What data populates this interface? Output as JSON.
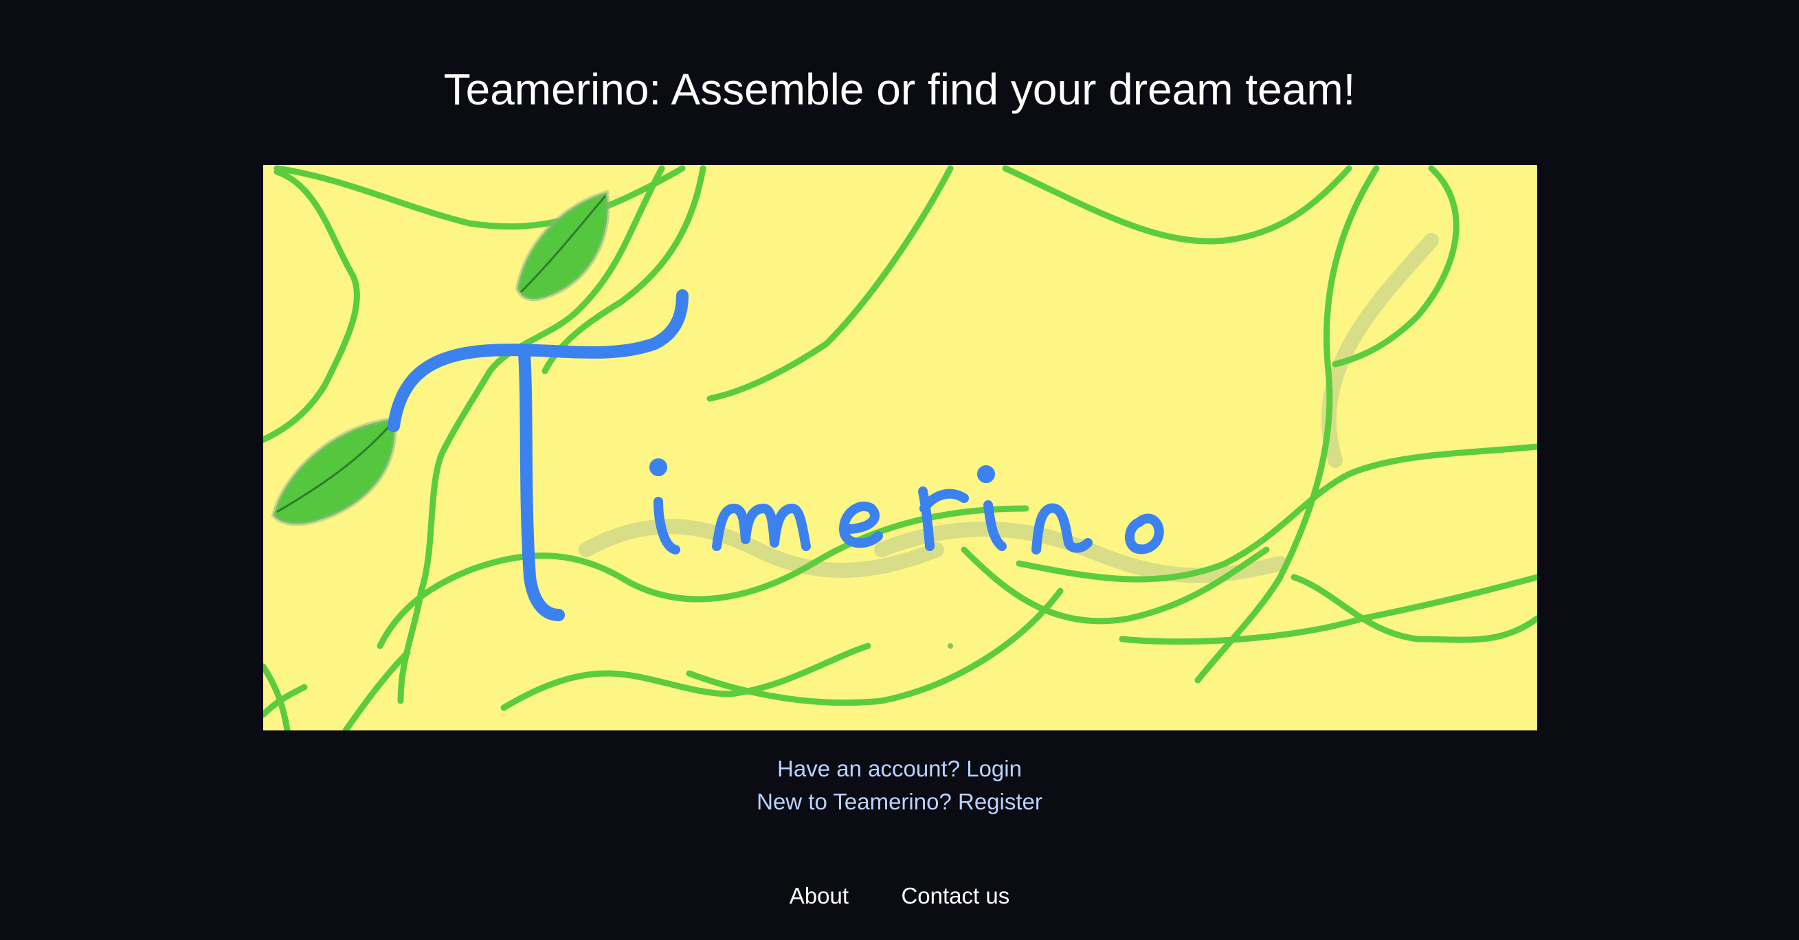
{
  "page": {
    "title": "Teamerino: Assemble or find your dream team!"
  },
  "banner": {
    "alt": "Teamerino",
    "background_color": "#fdf685",
    "vine_color": "#5ccc3f",
    "leaf_color": "#55c73e",
    "lettering_color": "#3b82f0"
  },
  "auth": {
    "login_text": "Have an account? Login",
    "register_text": "New to Teamerino? Register"
  },
  "footer": {
    "about_label": "About",
    "contact_label": "Contact us"
  }
}
